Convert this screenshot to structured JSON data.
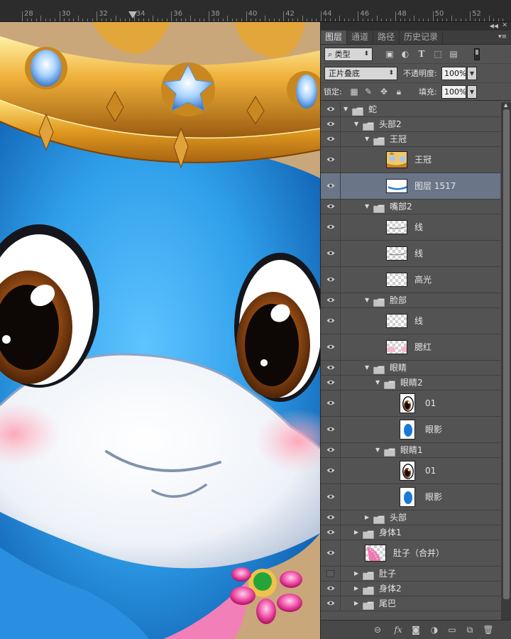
{
  "ruler": {
    "numbers": [
      "28",
      "30",
      "32",
      "34",
      "36",
      "38",
      "40",
      "42",
      "44",
      "46",
      "48",
      "50",
      "52"
    ]
  },
  "panel": {
    "tabs": [
      "图层",
      "通道",
      "路径",
      "历史记录"
    ],
    "filter": {
      "kind_label": "类型",
      "icons": [
        "image-filter-icon",
        "adjustment-filter-icon",
        "type-filter-icon",
        "shape-filter-icon",
        "smart-object-filter-icon"
      ]
    },
    "blend_mode": "正片叠底",
    "opacity_label": "不透明度:",
    "opacity_value": "100%",
    "lock_label": "锁定:",
    "fill_label": "填充:",
    "fill_value": "100%"
  },
  "layers": [
    {
      "name": "蛇",
      "type": "group",
      "expanded": true,
      "visible": true
    },
    {
      "name": "头部2",
      "type": "group",
      "expanded": true,
      "visible": true
    },
    {
      "name": "王冠",
      "type": "group",
      "expanded": true,
      "visible": true
    },
    {
      "name": "王冠",
      "type": "layer",
      "visible": true,
      "thumb": "crown"
    },
    {
      "name": "图层 1517",
      "type": "layer",
      "visible": true,
      "selected": true,
      "thumb": "bluebar"
    },
    {
      "name": "嘴部2",
      "type": "group",
      "expanded": true,
      "visible": true
    },
    {
      "name": "线",
      "type": "layer",
      "visible": true,
      "thumb": "line"
    },
    {
      "name": "线",
      "type": "layer",
      "visible": true,
      "thumb": "line"
    },
    {
      "name": "高光",
      "type": "layer",
      "visible": true,
      "thumb": "blank"
    },
    {
      "name": "脸部",
      "type": "group",
      "expanded": true,
      "visible": true
    },
    {
      "name": "线",
      "type": "layer",
      "visible": true,
      "thumb": "blank"
    },
    {
      "name": "腮红",
      "type": "layer",
      "visible": true,
      "thumb": "blush"
    },
    {
      "name": "眼睛",
      "type": "group",
      "expanded": true,
      "visible": true
    },
    {
      "name": "眼睛2",
      "type": "group",
      "expanded": true,
      "visible": true
    },
    {
      "name": "01",
      "type": "layer",
      "visible": true,
      "thumb": "eye"
    },
    {
      "name": "眼影",
      "type": "layer",
      "visible": true,
      "thumb": "shadow"
    },
    {
      "name": "眼睛1",
      "type": "group",
      "expanded": true,
      "visible": true
    },
    {
      "name": "01",
      "type": "layer",
      "visible": true,
      "thumb": "eye"
    },
    {
      "name": "眼影",
      "type": "layer",
      "visible": true,
      "thumb": "shadow"
    },
    {
      "name": "头部",
      "type": "group",
      "expanded": false,
      "visible": true
    },
    {
      "name": "身体1",
      "type": "group",
      "expanded": false,
      "visible": true
    },
    {
      "name": "肚子（合并）",
      "type": "layer",
      "visible": true,
      "thumb": "belly"
    },
    {
      "name": "肚子",
      "type": "group",
      "expanded": false,
      "visible": false
    },
    {
      "name": "身体2",
      "type": "group",
      "expanded": false,
      "visible": true
    },
    {
      "name": "尾巴",
      "type": "group",
      "expanded": false,
      "visible": true
    }
  ],
  "bottom_tools": [
    "link-layers-icon",
    "fx",
    "add-mask-icon",
    "adjustment-layer-icon",
    "new-group-icon",
    "new-layer-icon",
    "delete-layer-icon"
  ],
  "bottom_fx_label": "fx"
}
